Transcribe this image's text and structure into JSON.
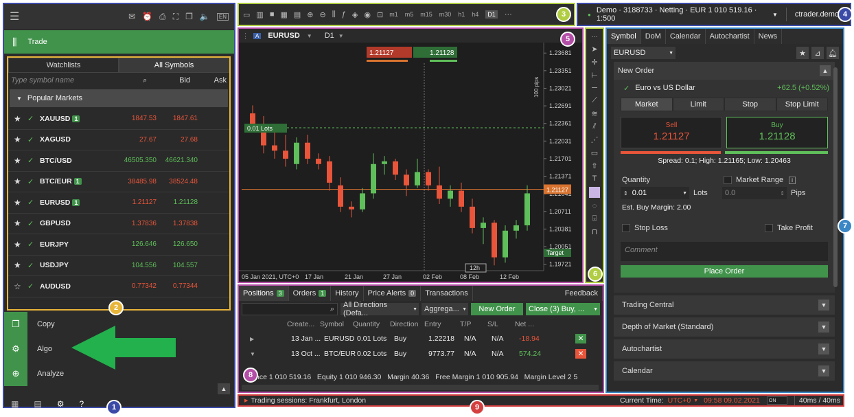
{
  "left": {
    "trade_label": "Trade",
    "tabs": [
      "Watchlists",
      "All Symbols"
    ],
    "search_placeholder": "Type symbol name",
    "bid_header": "Bid",
    "ask_header": "Ask",
    "group": "Popular Markets",
    "symbols": [
      {
        "star": "★",
        "name": "XAUUSD",
        "badge": "1",
        "bid": "1847.53",
        "ask": "1847.61",
        "color": "#e8553a"
      },
      {
        "star": "★",
        "name": "XAGUSD",
        "badge": "",
        "bid": "27.67",
        "ask": "27.68",
        "color": "#e8553a"
      },
      {
        "star": "★",
        "name": "BTC/USD",
        "badge": "",
        "bid": "46505.350",
        "ask": "46621.340",
        "color": "#5fbf5a"
      },
      {
        "star": "★",
        "name": "BTC/EUR",
        "badge": "1",
        "bid": "38485.98",
        "ask": "38524.48",
        "color": "#e8553a"
      },
      {
        "star": "★",
        "name": "EURUSD",
        "badge": "1",
        "bid": "1.21127",
        "ask": "1.21128",
        "color": "#e8553a",
        "ask_color": "#5fbf5a"
      },
      {
        "star": "★",
        "name": "GBPUSD",
        "badge": "",
        "bid": "1.37836",
        "ask": "1.37838",
        "color": "#e8553a"
      },
      {
        "star": "★",
        "name": "EURJPY",
        "badge": "",
        "bid": "126.646",
        "ask": "126.650",
        "color": "#5fbf5a"
      },
      {
        "star": "★",
        "name": "USDJPY",
        "badge": "",
        "bid": "104.556",
        "ask": "104.557",
        "color": "#5fbf5a"
      },
      {
        "star": "☆",
        "name": "AUDUSD",
        "badge": "",
        "bid": "0.77342",
        "ask": "0.77344",
        "color": "#e8553a"
      }
    ],
    "menu": [
      "Copy",
      "Algo",
      "Analyze"
    ]
  },
  "toolbar": {
    "timeframes": [
      "m1",
      "m5",
      "m15",
      "m30",
      "h1",
      "h4",
      "D1"
    ],
    "account_text": "Demo · 3188733 · Netting · EUR 1 010 519.16 · 1:500",
    "user": "ctrader.demo"
  },
  "chart": {
    "symbol": "EURUSD",
    "timeframe": "D1",
    "sell_price": "1.21127",
    "buy_price": "1.21128",
    "lots_label": "0.01 Lots",
    "pips_label": "100 pips",
    "y_ticks": [
      "1.23681",
      "1.23351",
      "1.23021",
      "1.22691",
      "1.22361",
      "1.22031",
      "1.21701",
      "1.21371",
      "1.21041",
      "1.20711",
      "1.20381",
      "1.20051",
      "1.19721"
    ],
    "current_price": "1.21127",
    "target_label": "Target",
    "x_ticks": [
      "05 Jan 2021, UTC+0",
      "17 Jan",
      "21 Jan",
      "27 Jan",
      "02 Feb",
      "08 Feb",
      "12 Feb"
    ],
    "crosshair_label": "12h"
  },
  "chart_data": {
    "type": "candlestick",
    "symbol": "EURUSD",
    "candles": [
      {
        "o": 1.2255,
        "h": 1.227,
        "l": 1.222,
        "c": 1.223
      },
      {
        "o": 1.223,
        "h": 1.225,
        "l": 1.218,
        "c": 1.2195
      },
      {
        "o": 1.2195,
        "h": 1.2225,
        "l": 1.217,
        "c": 1.2185
      },
      {
        "o": 1.2185,
        "h": 1.2215,
        "l": 1.2155,
        "c": 1.217
      },
      {
        "o": 1.216,
        "h": 1.221,
        "l": 1.215,
        "c": 1.22
      },
      {
        "o": 1.22,
        "h": 1.2215,
        "l": 1.216,
        "c": 1.217
      },
      {
        "o": 1.217,
        "h": 1.218,
        "l": 1.215,
        "c": 1.216
      },
      {
        "o": 1.2165,
        "h": 1.2175,
        "l": 1.211,
        "c": 1.2125
      },
      {
        "o": 1.212,
        "h": 1.2135,
        "l": 1.207,
        "c": 1.208
      },
      {
        "o": 1.208,
        "h": 1.209,
        "l": 1.206,
        "c": 1.2075
      },
      {
        "o": 1.2075,
        "h": 1.2115,
        "l": 1.207,
        "c": 1.2105
      },
      {
        "o": 1.2105,
        "h": 1.218,
        "l": 1.2095,
        "c": 1.216
      },
      {
        "o": 1.216,
        "h": 1.2175,
        "l": 1.214,
        "c": 1.2165
      },
      {
        "o": 1.2165,
        "h": 1.217,
        "l": 1.213,
        "c": 1.214
      },
      {
        "o": 1.214,
        "h": 1.215,
        "l": 1.21,
        "c": 1.212
      },
      {
        "o": 1.212,
        "h": 1.217,
        "l": 1.2115,
        "c": 1.2145
      },
      {
        "o": 1.2145,
        "h": 1.215,
        "l": 1.211,
        "c": 1.212
      },
      {
        "o": 1.212,
        "h": 1.2155,
        "l": 1.2085,
        "c": 1.2095
      },
      {
        "o": 1.2095,
        "h": 1.212,
        "l": 1.208,
        "c": 1.211
      },
      {
        "o": 1.211,
        "h": 1.2125,
        "l": 1.207,
        "c": 1.208
      },
      {
        "o": 1.208,
        "h": 1.2095,
        "l": 1.203,
        "c": 1.204
      },
      {
        "o": 1.204,
        "h": 1.206,
        "l": 1.201,
        "c": 1.205
      },
      {
        "o": 1.205,
        "h": 1.2055,
        "l": 1.197,
        "c": 1.1985
      },
      {
        "o": 1.1985,
        "h": 1.2045,
        "l": 1.1975,
        "c": 1.2035
      },
      {
        "o": 1.2035,
        "h": 1.2055,
        "l": 1.202,
        "c": 1.2045
      },
      {
        "o": 1.2045,
        "h": 1.212,
        "l": 1.2035,
        "c": 1.2105
      }
    ],
    "ylim": [
      1.196,
      1.238
    ]
  },
  "positions": {
    "tabs": [
      {
        "label": "Positions",
        "badge": "3"
      },
      {
        "label": "Orders",
        "badge": "1"
      },
      {
        "label": "History",
        "badge": ""
      },
      {
        "label": "Price Alerts",
        "badge": "0"
      },
      {
        "label": "Transactions",
        "badge": ""
      }
    ],
    "feedback": "Feedback",
    "filter": "All Directions (Defa...",
    "aggregate": "Aggrega...",
    "new_order": "New Order",
    "close_btn": "Close (3) Buy, ...",
    "headers": [
      "Create...",
      "Symbol",
      "Quantity",
      "Direction",
      "Entry",
      "T/P",
      "S/L",
      "Net ..."
    ],
    "rows": [
      {
        "created": "13 Jan ...",
        "symbol": "EURUSD",
        "qty": "0.01 Lots",
        "dir": "Buy",
        "entry": "1.22218",
        "tp": "N/A",
        "sl": "N/A",
        "net": "-18.94",
        "net_color": "#e8553a"
      },
      {
        "created": "13 Oct ...",
        "symbol": "BTC/EUR",
        "qty": "0.02 Lots",
        "dir": "Buy",
        "entry": "9773.77",
        "tp": "N/A",
        "sl": "N/A",
        "net": "574.24",
        "net_color": "#5fbf5a"
      }
    ],
    "summary": "nce 1 010 519.16   Equity 1 010 946.30   Margin 40.36   Free Margin 1 010 905.94   Margin Level 2 5"
  },
  "right": {
    "tabs": [
      "Symbol",
      "DoM",
      "Calendar",
      "Autochartist",
      "News"
    ],
    "symbol": "EURUSD",
    "new_order": "New Order",
    "instrument": "Euro vs US Dollar",
    "change": "+62.5 (+0.52%)",
    "order_types": [
      "Market",
      "Limit",
      "Stop",
      "Stop Limit"
    ],
    "sell_label": "Sell",
    "sell_price": "1.21127",
    "buy_label": "Buy",
    "buy_price": "1.21128",
    "spread": "Spread: 0.1; High: 1.21165; Low: 1.20463",
    "quantity_label": "Quantity",
    "quantity": "0.01",
    "lots": "Lots",
    "market_range": "Market Range",
    "range_value": "0.0",
    "pips": "Pips",
    "margin": "Est. Buy Margin: 2.00",
    "stop_loss": "Stop Loss",
    "take_profit": "Take Profit",
    "comment_placeholder": "Comment",
    "place_order": "Place Order",
    "sections": [
      "Trading Central",
      "Depth of Market (Standard)",
      "Autochartist",
      "Calendar"
    ]
  },
  "status": {
    "sessions": "Trading sessions: Frankfurt, London",
    "time_label": "Current Time:",
    "tz": "UTC+0",
    "time": "09:58 09.02.2021",
    "latency": "40ms / 40ms"
  },
  "markers": [
    "1",
    "2",
    "3",
    "4",
    "5",
    "6",
    "7",
    "8",
    "9"
  ]
}
